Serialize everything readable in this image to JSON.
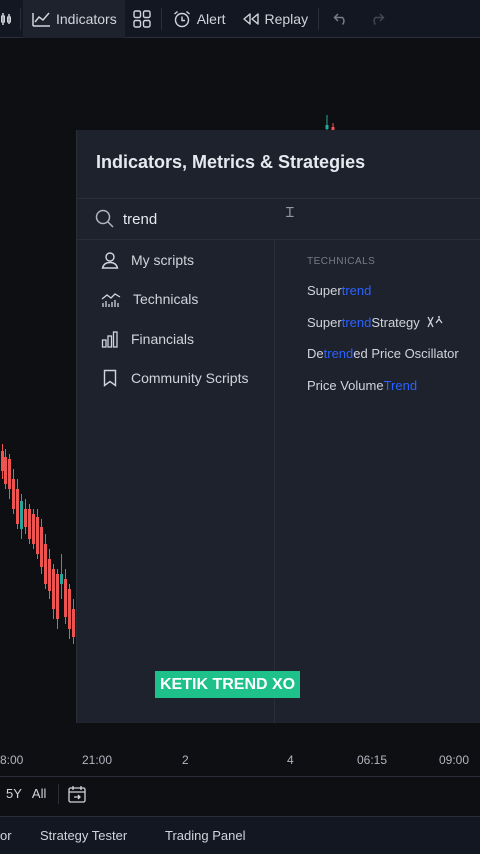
{
  "toolbar": {
    "indicators_label": "Indicators",
    "alert_label": "Alert",
    "replay_label": "Replay"
  },
  "dialog": {
    "title": "Indicators, Metrics & Strategies",
    "search_value": "trend",
    "sidebar": [
      {
        "label": "My scripts",
        "icon": "user-icon"
      },
      {
        "label": "Technicals",
        "icon": "technicals-chart-icon"
      },
      {
        "label": "Financials",
        "icon": "bar-chart-icon"
      },
      {
        "label": "Community Scripts",
        "icon": "bookmark-icon"
      }
    ],
    "section_header": "TECHNICALS",
    "results": [
      {
        "pre": "Super",
        "match": "trend",
        "post": ""
      },
      {
        "pre": "Super",
        "match": "trend",
        "post": " Strategy"
      },
      {
        "pre": "De",
        "match": "trend",
        "post": "ed Price Oscillator"
      },
      {
        "pre": "Price Volume ",
        "match": "Trend",
        "post": ""
      }
    ]
  },
  "caption": "KETIK TREND XO",
  "time_axis": [
    "8:00",
    "21:00",
    "2",
    "4",
    "06:15",
    "09:00"
  ],
  "range_bar": [
    "5Y",
    "All"
  ],
  "bottom_tabs": [
    "or",
    "Strategy Tester",
    "Trading Panel"
  ],
  "colors": {
    "accent": "#2962ff",
    "caption_bg": "#1ec18a",
    "candle_up": "#26a69a",
    "candle_down": "#ef5350"
  }
}
